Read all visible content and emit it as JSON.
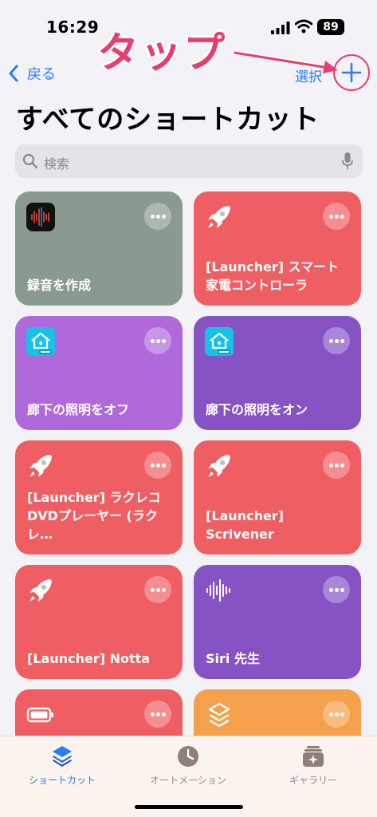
{
  "status": {
    "time": "16:29",
    "battery": "89"
  },
  "annotation": {
    "text": "タップ",
    "color": "#e83e6e"
  },
  "nav": {
    "back_label": "戻る",
    "select_label": "選択"
  },
  "title": "すべてのショートカット",
  "search": {
    "placeholder": "検索"
  },
  "shortcuts": [
    {
      "label": "録音を作成",
      "icon": "voice-memo-icon",
      "color": "#8a9a8f"
    },
    {
      "label": "[Launcher] スマート家電コントローラ",
      "icon": "rocket-icon",
      "color": "#ef5e62"
    },
    {
      "label": "廊下の照明をオフ",
      "icon": "home-style-icon",
      "color": "#b069db"
    },
    {
      "label": "廊下の照明をオン",
      "icon": "home-style-icon",
      "color": "#8653c4"
    },
    {
      "label": "[Launcher] ラクレコDVDプレーヤー (ラクレ…",
      "icon": "rocket-icon",
      "color": "#ef5e62"
    },
    {
      "label": "[Launcher] Scrivener",
      "icon": "rocket-icon",
      "color": "#ef5e62"
    },
    {
      "label": "[Launcher] Notta",
      "icon": "rocket-icon",
      "color": "#ef5e62"
    },
    {
      "label": "Siri 先生",
      "icon": "waveform-icon",
      "color": "#8653c4"
    },
    {
      "label": "",
      "icon": "battery-icon",
      "color": "#ef5e62"
    },
    {
      "label": "",
      "icon": "layers-icon",
      "color": "#f5a04b"
    }
  ],
  "tabs": [
    {
      "label": "ショートカット",
      "icon": "shortcuts-stack-icon",
      "active": true
    },
    {
      "label": "オートメーション",
      "icon": "clock-icon",
      "active": false
    },
    {
      "label": "ギャラリー",
      "icon": "gallery-icon",
      "active": false
    }
  ],
  "colors": {
    "accent": "#2b7cf6",
    "background": "#f2f2f7",
    "tabbar": "#fbf3ee"
  }
}
